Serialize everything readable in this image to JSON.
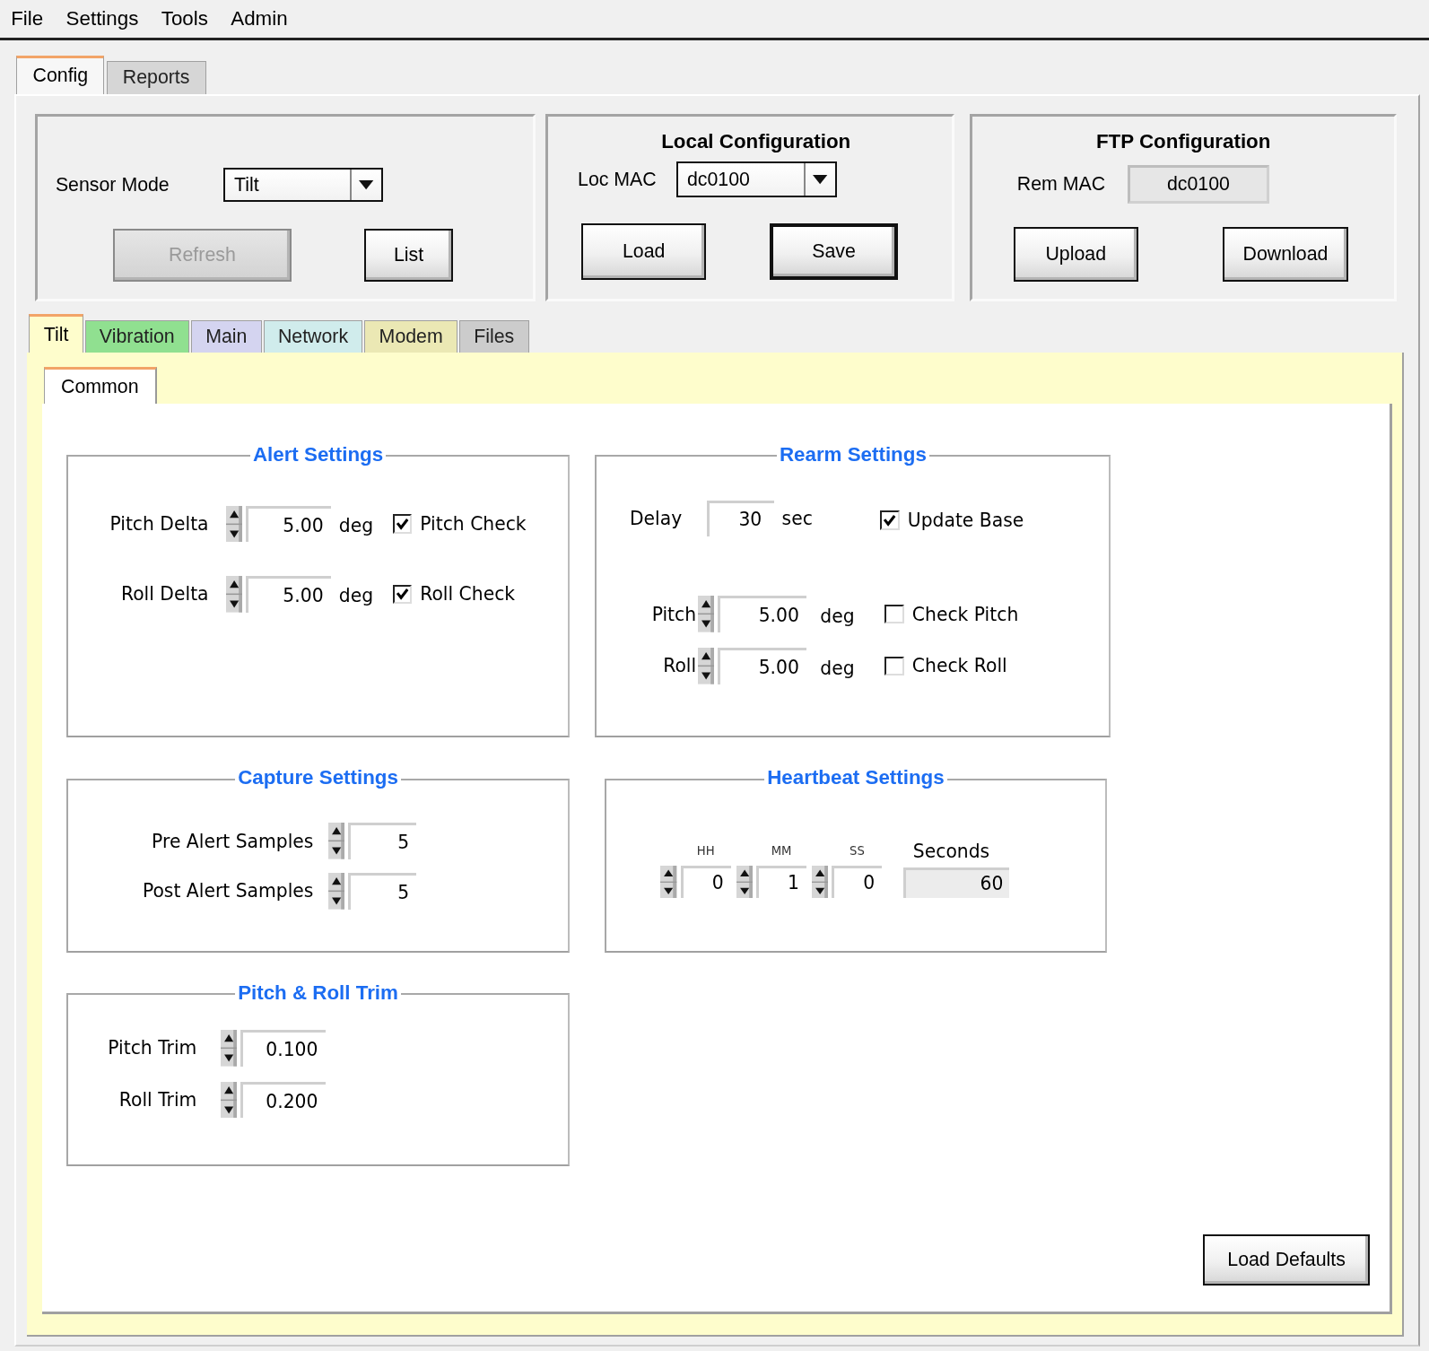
{
  "menu": [
    {
      "label": "File"
    },
    {
      "label": "Settings"
    },
    {
      "label": "Tools"
    },
    {
      "label": "Admin"
    }
  ],
  "outer_tabs": [
    {
      "label": "Config",
      "selected": true
    },
    {
      "label": "Reports",
      "selected": false
    }
  ],
  "sensor_panel": {
    "sensor_mode_label": "Sensor Mode",
    "sensor_mode": "Tilt",
    "buttons": [
      {
        "label": "Refresh",
        "disabled": true
      },
      {
        "label": "List",
        "disabled": false
      }
    ]
  },
  "local_configuration": {
    "title": "Local Configuration",
    "mac_label": "Loc MAC",
    "mac": "dc0100",
    "buttons": [
      {
        "label": "Load",
        "default": false
      },
      {
        "label": "Save",
        "default": true
      }
    ]
  },
  "ftp_configuration": {
    "title": "FTP Configuration",
    "mac_label": "Rem MAC",
    "mac": "dc0100",
    "buttons": [
      {
        "label": "Upload"
      },
      {
        "label": "Download"
      }
    ]
  },
  "sensor_tabs": [
    {
      "label": "Tilt",
      "selected": true,
      "color": "#fefdcc"
    },
    {
      "label": "Vibration",
      "selected": false,
      "color": "#90e090"
    },
    {
      "label": "Main",
      "selected": false,
      "color": "#d4d4f0"
    },
    {
      "label": "Network",
      "selected": false,
      "color": "#d0ecec"
    },
    {
      "label": "Modem",
      "selected": false,
      "color": "#ebe8b4"
    },
    {
      "label": "Files",
      "selected": false,
      "color": "#cccccc"
    }
  ],
  "sub_tabs": [
    {
      "label": "Common",
      "selected": true
    }
  ],
  "alert_settings": {
    "title": "Alert Settings",
    "rows": [
      {
        "label": "Pitch Delta",
        "value": "5.00",
        "unit": "deg",
        "check_label": "Pitch Check",
        "checked": true
      },
      {
        "label": "Roll Delta",
        "value": "5.00",
        "unit": "deg",
        "check_label": "Roll Check",
        "checked": true
      }
    ]
  },
  "rearm_settings": {
    "title": "Rearm Settings",
    "delay_label": "Delay",
    "delay": "30",
    "delay_unit": "sec",
    "update_base_label": "Update Base",
    "update_base_checked": true,
    "rows": [
      {
        "label": "Pitch",
        "value": "5.00",
        "unit": "deg",
        "check_label": "Check Pitch",
        "checked": false
      },
      {
        "label": "Roll",
        "value": "5.00",
        "unit": "deg",
        "check_label": "Check Roll",
        "checked": false
      }
    ]
  },
  "capture_settings": {
    "title": "Capture Settings",
    "rows": [
      {
        "label": "Pre Alert Samples",
        "value": "5"
      },
      {
        "label": "Post Alert Samples",
        "value": "5"
      }
    ]
  },
  "heartbeat_settings": {
    "title": "Heartbeat Settings",
    "fields": [
      {
        "label": "HH",
        "value": "0"
      },
      {
        "label": "MM",
        "value": "1"
      },
      {
        "label": "SS",
        "value": "0"
      }
    ],
    "seconds_label": "Seconds",
    "seconds": "60"
  },
  "trim_settings": {
    "title": "Pitch & Roll Trim",
    "rows": [
      {
        "label": "Pitch Trim",
        "value": "0.100"
      },
      {
        "label": "Roll Trim",
        "value": "0.200"
      }
    ]
  },
  "load_defaults_button": "Load Defaults"
}
